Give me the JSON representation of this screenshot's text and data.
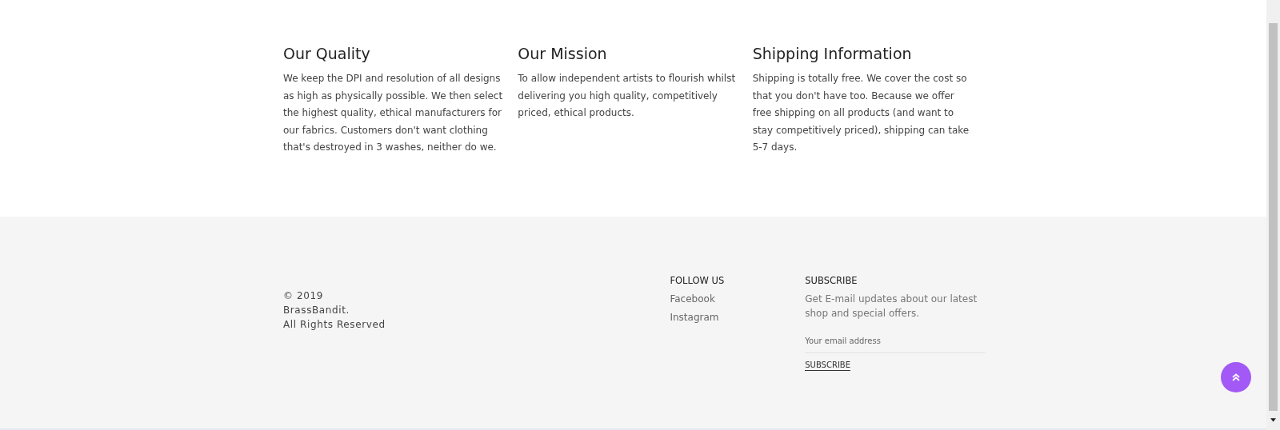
{
  "features": [
    {
      "title": "Our Quality",
      "text": "We keep the DPI and resolution of all designs as high as physically possible. We then select the highest quality, ethical manufacturers for our fabrics. Customers don't want clothing that's destroyed in 3 washes, neither do we."
    },
    {
      "title": "Our Mission",
      "text": "To allow independent artists to flourish whilst delivering you high quality, competitively priced, ethical products."
    },
    {
      "title": "Shipping Information",
      "text": "Shipping is totally free. We cover the cost so that you don't have too. Because we offer free shipping on all products (and want to stay competitively priced), shipping can take 5-7 days."
    }
  ],
  "footer": {
    "copyright": [
      "© 2019",
      "BrassBandit.",
      "All Rights Reserved"
    ],
    "follow": {
      "heading": "FOLLOW US",
      "links": [
        "Facebook",
        "Instagram"
      ]
    },
    "subscribe": {
      "heading": "SUBSCRIBE",
      "text": "Get E-mail updates about our latest shop and special offers.",
      "placeholder": "Your email address",
      "button": "SUBSCRIBE"
    }
  }
}
